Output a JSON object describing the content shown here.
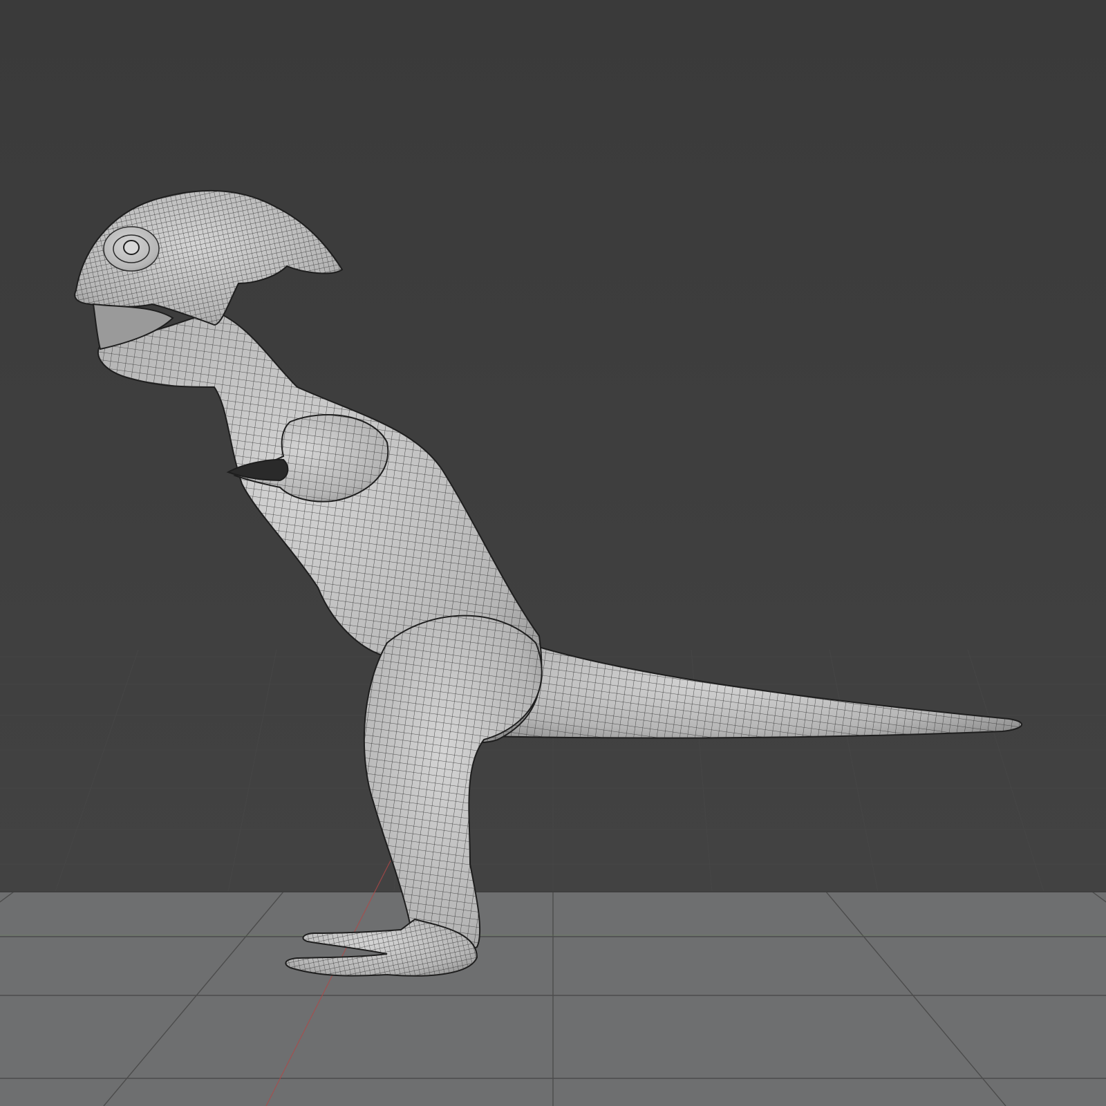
{
  "viewport": {
    "background_color": "#3b3b3b",
    "floor_color": "#6e6f70",
    "grid_line_color": "#505050",
    "mesh_fill_color": "#bdbdbd",
    "wire_color": "#2a2a2a",
    "axis_x_color": "#b04848",
    "axis_y_color": "#6a9a4a",
    "shading": "wireframe-overlay",
    "subject": "lizard-creature-mesh"
  }
}
